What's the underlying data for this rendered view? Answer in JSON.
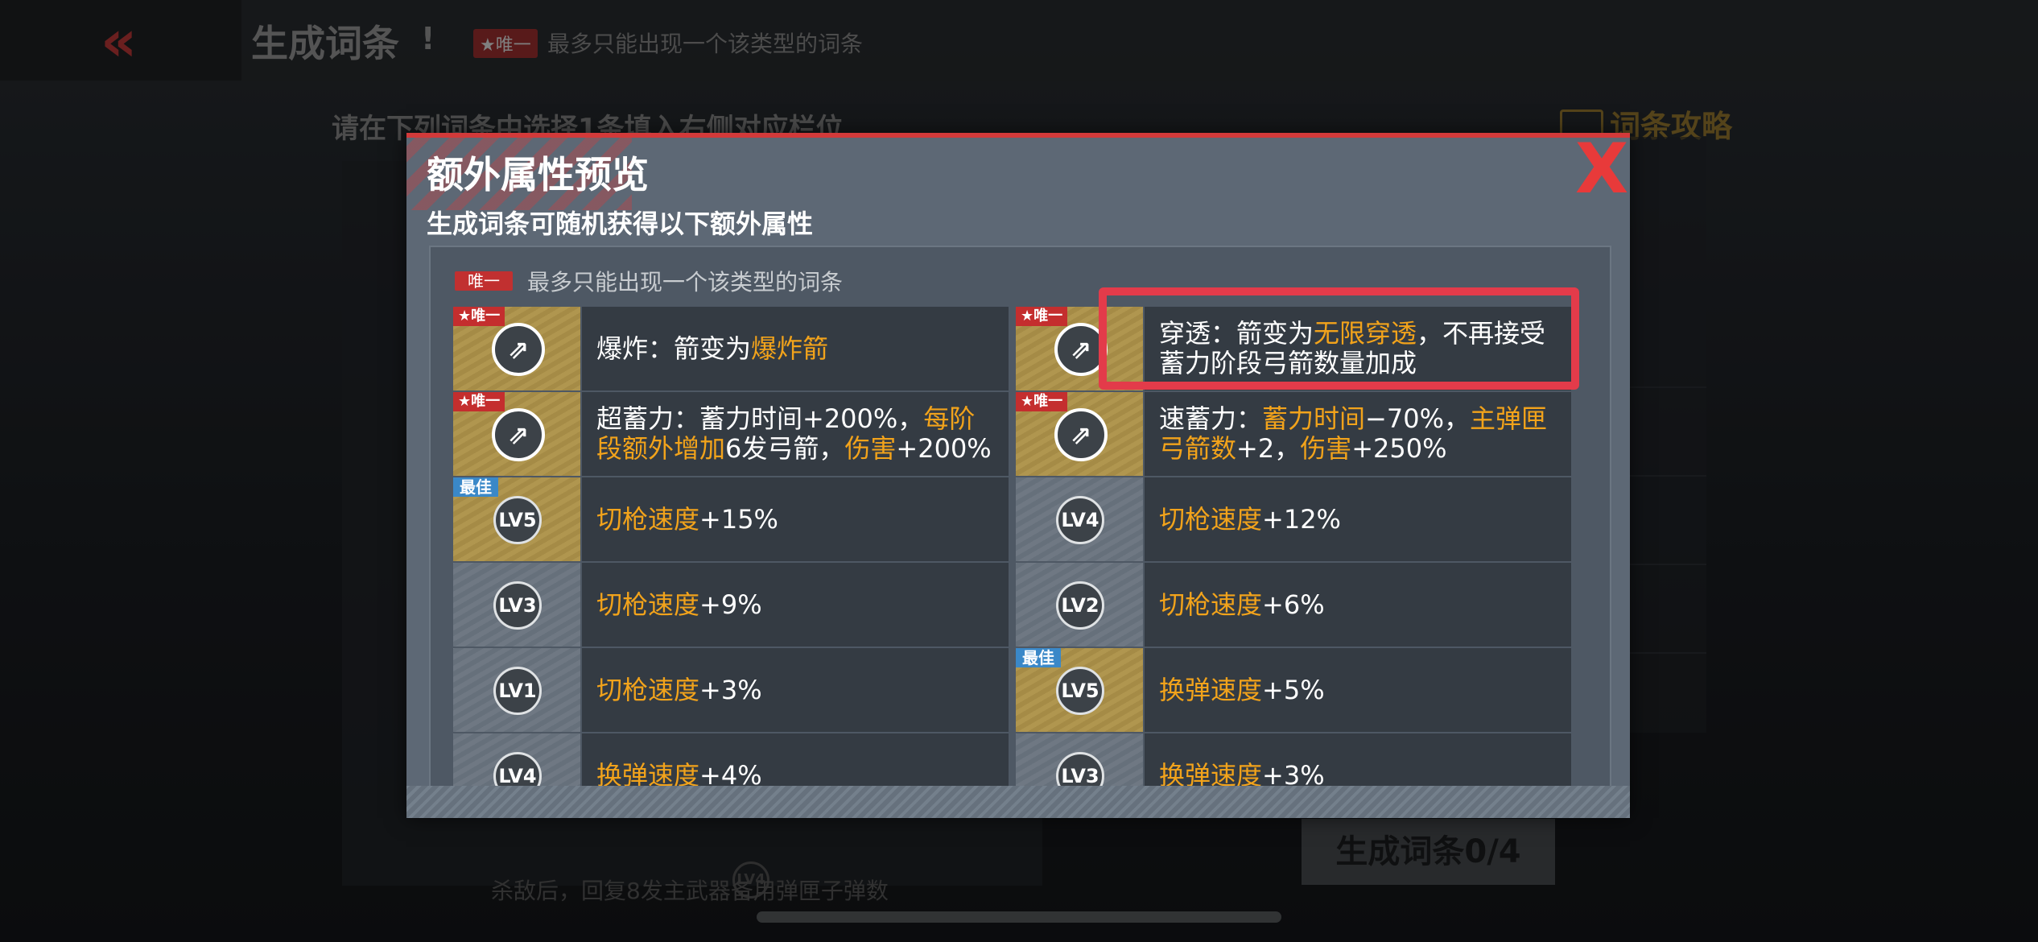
{
  "header": {
    "title": "生成词条",
    "info": "!",
    "unique_tag": "★唯一",
    "note": "最多只能出现一个该类型的词条"
  },
  "background": {
    "instruction": "请在下列词条中选择1条填入右侧对应栏位",
    "guide": "词条攻略",
    "row_lv": "LV4",
    "row_text": "杀敌后，回复8发主武器备用弹匣子弹数",
    "generate_button": "生成词条0/4"
  },
  "modal": {
    "title": "额外属性预览",
    "subtitle": "生成词条可随机获得以下额外属性",
    "close": "X",
    "legend_tag": "唯一",
    "legend_text": "最多只能出现一个该类型的词条",
    "cells": [
      {
        "badge": "★唯一",
        "icon": "",
        "parts": [
          {
            "t": "爆炸：箭变为",
            "h": false
          },
          {
            "t": "爆炸箭",
            "h": true
          }
        ]
      },
      {
        "badge": "★唯一",
        "icon": "",
        "parts": [
          {
            "t": "穿透：箭变为",
            "h": false
          },
          {
            "t": "无限穿透",
            "h": true
          },
          {
            "t": "，不再接受蓄力阶段弓箭数量加成",
            "h": false
          }
        ]
      },
      {
        "badge": "★唯一",
        "icon": "",
        "parts": [
          {
            "t": "超蓄力：蓄力时间+200%，",
            "h": false
          },
          {
            "t": "每阶段额外增加",
            "h": true
          },
          {
            "t": "6发弓箭，",
            "h": false
          },
          {
            "t": "伤害",
            "h": true
          },
          {
            "t": "+200%",
            "h": false
          }
        ]
      },
      {
        "badge": "★唯一",
        "icon": "",
        "parts": [
          {
            "t": "速蓄力：",
            "h": false
          },
          {
            "t": "蓄力时间",
            "h": true
          },
          {
            "t": "−70%，",
            "h": false
          },
          {
            "t": "主弹匣弓箭数",
            "h": true
          },
          {
            "t": "+2，",
            "h": false
          },
          {
            "t": "伤害",
            "h": true
          },
          {
            "t": "+250%",
            "h": false
          }
        ]
      },
      {
        "badge": "最佳",
        "icon": "LV5",
        "parts": [
          {
            "t": "切枪速度",
            "h": true
          },
          {
            "t": "+15%",
            "h": false
          }
        ]
      },
      {
        "badge": "",
        "icon": "LV4",
        "parts": [
          {
            "t": "切枪速度",
            "h": true
          },
          {
            "t": "+12%",
            "h": false
          }
        ]
      },
      {
        "badge": "",
        "icon": "LV3",
        "parts": [
          {
            "t": "切枪速度",
            "h": true
          },
          {
            "t": "+9%",
            "h": false
          }
        ]
      },
      {
        "badge": "",
        "icon": "LV2",
        "parts": [
          {
            "t": "切枪速度",
            "h": true
          },
          {
            "t": "+6%",
            "h": false
          }
        ]
      },
      {
        "badge": "",
        "icon": "LV1",
        "parts": [
          {
            "t": "切枪速度",
            "h": true
          },
          {
            "t": "+3%",
            "h": false
          }
        ]
      },
      {
        "badge": "最佳",
        "icon": "LV5",
        "parts": [
          {
            "t": "换弹速度",
            "h": true
          },
          {
            "t": "+5%",
            "h": false
          }
        ]
      },
      {
        "badge": "",
        "icon": "LV4",
        "parts": [
          {
            "t": "换弹速度",
            "h": true
          },
          {
            "t": "+4%",
            "h": false
          }
        ]
      },
      {
        "badge": "",
        "icon": "LV3",
        "parts": [
          {
            "t": "换弹速度",
            "h": true
          },
          {
            "t": "+3%",
            "h": false
          }
        ]
      }
    ]
  }
}
